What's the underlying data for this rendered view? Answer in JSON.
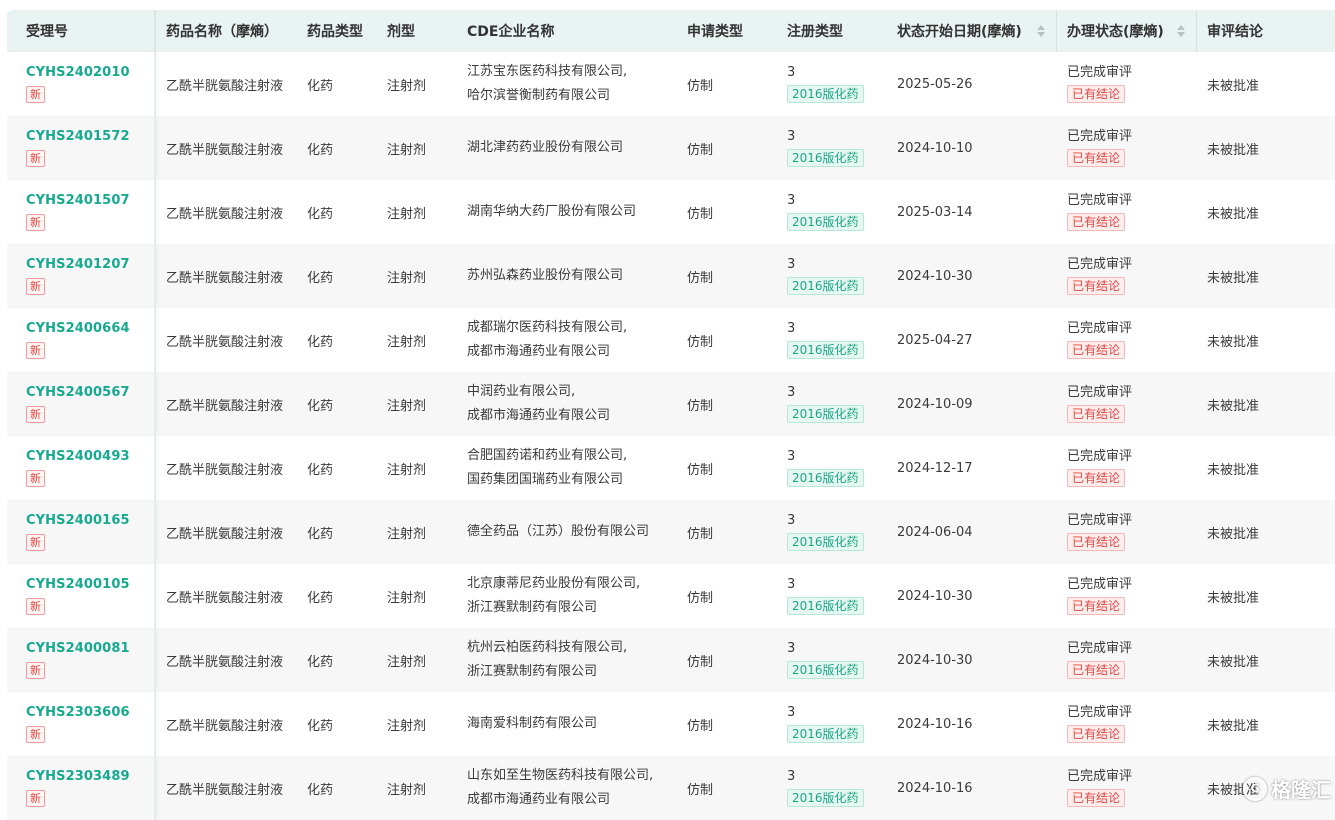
{
  "columns": [
    {
      "key": "accept_no",
      "label": "受理号",
      "width": 149
    },
    {
      "key": "drug_name",
      "label": "药品名称（摩熵）",
      "width": 141
    },
    {
      "key": "drug_type",
      "label": "药品类型",
      "width": 80
    },
    {
      "key": "dosage_form",
      "label": "剂型",
      "width": 80
    },
    {
      "key": "company",
      "label": "CDE企业名称",
      "width": 220
    },
    {
      "key": "apply_type",
      "label": "申请类型",
      "width": 100
    },
    {
      "key": "reg_type",
      "label": "注册类型",
      "width": 110
    },
    {
      "key": "start_date",
      "label": "状态开始日期(摩熵)",
      "width": 170,
      "sortable": true
    },
    {
      "key": "status",
      "label": "办理状态(摩熵)",
      "width": 140,
      "sortable": true
    },
    {
      "key": "conclusion",
      "label": "审评结论",
      "width": 138
    }
  ],
  "new_tag": "新",
  "reg_tag": "2016版化药",
  "status_tag": "已有结论",
  "rows": [
    {
      "accept_no": "CYHS2402010",
      "drug_name": "乙酰半胱氨酸注射液",
      "drug_type": "化药",
      "dosage_form": "注射剂",
      "company": [
        "江苏宝东医药科技有限公司,",
        "哈尔滨誉衡制药有限公司"
      ],
      "apply_type": "仿制",
      "reg_num": "3",
      "start_date": "2025-05-26",
      "status": "已完成审评",
      "conclusion": "未被批准"
    },
    {
      "accept_no": "CYHS2401572",
      "drug_name": "乙酰半胱氨酸注射液",
      "drug_type": "化药",
      "dosage_form": "注射剂",
      "company": [
        "湖北津药药业股份有限公司"
      ],
      "apply_type": "仿制",
      "reg_num": "3",
      "start_date": "2024-10-10",
      "status": "已完成审评",
      "conclusion": "未被批准"
    },
    {
      "accept_no": "CYHS2401507",
      "drug_name": "乙酰半胱氨酸注射液",
      "drug_type": "化药",
      "dosage_form": "注射剂",
      "company": [
        "湖南华纳大药厂股份有限公司"
      ],
      "apply_type": "仿制",
      "reg_num": "3",
      "start_date": "2025-03-14",
      "status": "已完成审评",
      "conclusion": "未被批准"
    },
    {
      "accept_no": "CYHS2401207",
      "drug_name": "乙酰半胱氨酸注射液",
      "drug_type": "化药",
      "dosage_form": "注射剂",
      "company": [
        "苏州弘森药业股份有限公司"
      ],
      "apply_type": "仿制",
      "reg_num": "3",
      "start_date": "2024-10-30",
      "status": "已完成审评",
      "conclusion": "未被批准"
    },
    {
      "accept_no": "CYHS2400664",
      "drug_name": "乙酰半胱氨酸注射液",
      "drug_type": "化药",
      "dosage_form": "注射剂",
      "company": [
        "成都瑞尔医药科技有限公司,",
        "成都市海通药业有限公司"
      ],
      "apply_type": "仿制",
      "reg_num": "3",
      "start_date": "2025-04-27",
      "status": "已完成审评",
      "conclusion": "未被批准"
    },
    {
      "accept_no": "CYHS2400567",
      "drug_name": "乙酰半胱氨酸注射液",
      "drug_type": "化药",
      "dosage_form": "注射剂",
      "company": [
        "中润药业有限公司,",
        "成都市海通药业有限公司"
      ],
      "apply_type": "仿制",
      "reg_num": "3",
      "start_date": "2024-10-09",
      "status": "已完成审评",
      "conclusion": "未被批准"
    },
    {
      "accept_no": "CYHS2400493",
      "drug_name": "乙酰半胱氨酸注射液",
      "drug_type": "化药",
      "dosage_form": "注射剂",
      "company": [
        "合肥国药诺和药业有限公司,",
        "国药集团国瑞药业有限公司"
      ],
      "apply_type": "仿制",
      "reg_num": "3",
      "start_date": "2024-12-17",
      "status": "已完成审评",
      "conclusion": "未被批准"
    },
    {
      "accept_no": "CYHS2400165",
      "drug_name": "乙酰半胱氨酸注射液",
      "drug_type": "化药",
      "dosage_form": "注射剂",
      "company": [
        "德全药品（江苏）股份有限公司"
      ],
      "apply_type": "仿制",
      "reg_num": "3",
      "start_date": "2024-06-04",
      "status": "已完成审评",
      "conclusion": "未被批准"
    },
    {
      "accept_no": "CYHS2400105",
      "drug_name": "乙酰半胱氨酸注射液",
      "drug_type": "化药",
      "dosage_form": "注射剂",
      "company": [
        "北京康蒂尼药业股份有限公司,",
        "浙江赛默制药有限公司"
      ],
      "apply_type": "仿制",
      "reg_num": "3",
      "start_date": "2024-10-30",
      "status": "已完成审评",
      "conclusion": "未被批准"
    },
    {
      "accept_no": "CYHS2400081",
      "drug_name": "乙酰半胱氨酸注射液",
      "drug_type": "化药",
      "dosage_form": "注射剂",
      "company": [
        "杭州云柏医药科技有限公司,",
        "浙江赛默制药有限公司"
      ],
      "apply_type": "仿制",
      "reg_num": "3",
      "start_date": "2024-10-30",
      "status": "已完成审评",
      "conclusion": "未被批准"
    },
    {
      "accept_no": "CYHS2303606",
      "drug_name": "乙酰半胱氨酸注射液",
      "drug_type": "化药",
      "dosage_form": "注射剂",
      "company": [
        "海南爱科制药有限公司"
      ],
      "apply_type": "仿制",
      "reg_num": "3",
      "start_date": "2024-10-16",
      "status": "已完成审评",
      "conclusion": "未被批准"
    },
    {
      "accept_no": "CYHS2303489",
      "drug_name": "乙酰半胱氨酸注射液",
      "drug_type": "化药",
      "dosage_form": "注射剂",
      "company": [
        "山东如至生物医药科技有限公司,",
        "成都市海通药业有限公司"
      ],
      "apply_type": "仿制",
      "reg_num": "3",
      "start_date": "2024-10-16",
      "status": "已完成审评",
      "conclusion": "未被批准"
    }
  ],
  "watermark": {
    "icon": "G",
    "text": "格隆汇"
  }
}
